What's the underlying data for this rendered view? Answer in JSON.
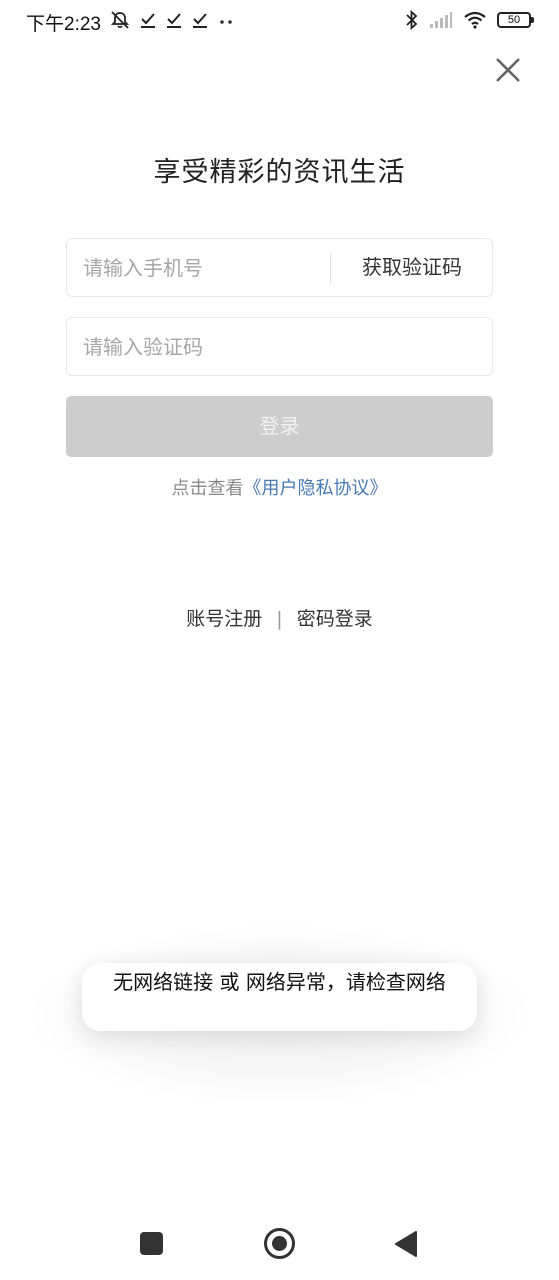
{
  "status_bar": {
    "time": "下午2:23",
    "battery": "50",
    "left_icons": [
      "mute-bell-icon",
      "check-icon",
      "check-icon",
      "check-icon",
      "more-dots-icon"
    ],
    "right_icons": [
      "bluetooth-icon",
      "signal-icon",
      "wifi-icon",
      "battery-icon"
    ]
  },
  "page": {
    "title": "享受精彩的资讯生活"
  },
  "form": {
    "phone_placeholder": "请输入手机号",
    "get_code_label": "获取验证码",
    "code_placeholder": "请输入验证码",
    "login_label": "登录"
  },
  "privacy": {
    "prefix": "点击查看",
    "link": "《用户隐私协议》"
  },
  "links": {
    "register": "账号注册",
    "separator": "|",
    "password_login": "密码登录"
  },
  "toast": {
    "message": "无网络链接 或 网络异常，请检查网络"
  },
  "nav": {
    "icons": [
      "recents-square-icon",
      "home-circle-icon",
      "back-triangle-icon"
    ]
  },
  "colors": {
    "login_disabled_bg": "#cdcdcd",
    "link_blue": "#4a78b4"
  }
}
